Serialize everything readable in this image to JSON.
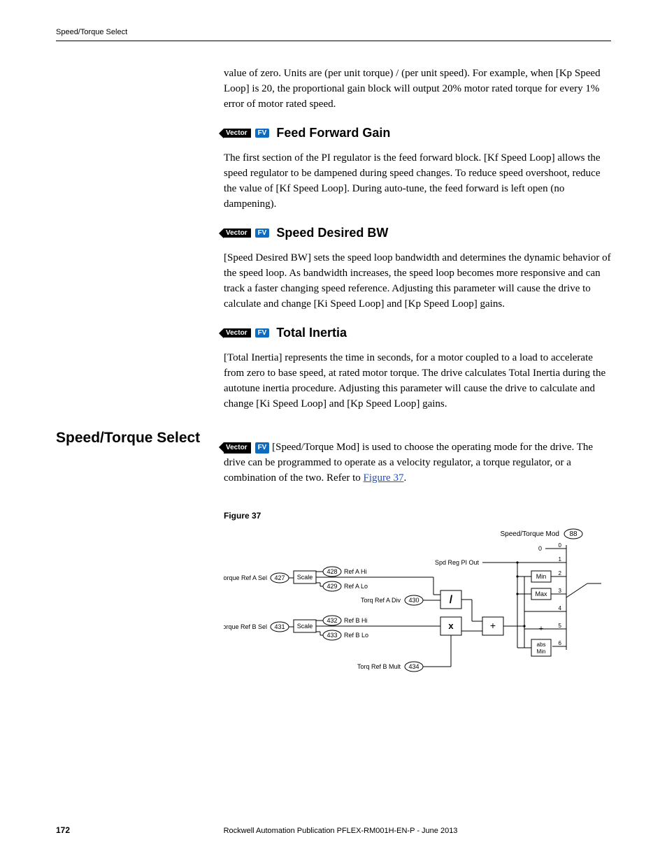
{
  "runhead": "Speed/Torque Select",
  "intro_paragraph": "value of zero. Units are (per unit torque) / (per unit speed). For example, when [Kp Speed Loop] is 20, the proportional gain block will output 20% motor rated torque for every 1% error of motor rated speed.",
  "badges": {
    "vector": "Vector",
    "fv": "FV"
  },
  "sections": {
    "feed_forward": {
      "title": "Feed Forward Gain",
      "body": "The first section of the PI regulator is the feed forward block. [Kf Speed Loop] allows the speed regulator to be dampened during speed changes. To reduce speed overshoot, reduce the value of [Kf Speed Loop]. During auto-tune, the feed forward is left open (no dampening)."
    },
    "speed_desired_bw": {
      "title": "Speed Desired BW",
      "body": "[Speed Desired BW] sets the speed loop bandwidth and determines the dynamic behavior of the speed loop. As bandwidth increases, the speed loop becomes more responsive and can track a faster changing speed reference. Adjusting this parameter will cause the drive to calculate and change [Ki Speed Loop] and [Kp Speed Loop] gains."
    },
    "total_inertia": {
      "title": "Total Inertia",
      "body": "[Total Inertia] represents the time in seconds, for a motor coupled to a load to accelerate from zero to base speed, at rated motor torque. The drive calculates Total Inertia during the autotune inertia procedure. Adjusting this parameter will cause the drive to calculate and change [Ki Speed Loop] and [Kp Speed Loop] gains."
    },
    "speed_torque_select": {
      "title": "Speed/Torque Select",
      "body_before_link": "[Speed/Torque Mod] is used to choose the operating mode for the drive. The drive can be programmed to operate as a velocity regulator, a torque regulator, or a combination of the two. Refer to ",
      "link_text": "Figure 37",
      "body_after_link": "."
    }
  },
  "figure": {
    "label": "Figure 37",
    "labels": {
      "speed_torque_mod": "Speed/Torque Mod",
      "spd_reg_pi_out": "Spd Reg PI Out",
      "torque_ref_a_sel": "Torque Ref A Sel",
      "torque_ref_b_sel": "Torque Ref B Sel",
      "ref_a_hi": "Ref A Hi",
      "ref_a_lo": "Ref A Lo",
      "ref_b_hi": "Ref B Hi",
      "ref_b_lo": "Ref B Lo",
      "torq_ref_a_div": "Torq Ref A Div",
      "torq_ref_b_mult": "Torq Ref B Mult",
      "scale": "Scale",
      "min": "Min",
      "max": "Max",
      "abs_min": "abs\nMin",
      "divide": "/",
      "mult": "x",
      "plus": "+"
    },
    "params": {
      "speed_torque_mod": 88,
      "torque_ref_a_sel": 427,
      "ref_a_hi": 428,
      "ref_a_lo": 429,
      "torq_ref_a_div": 430,
      "torque_ref_b_sel": 431,
      "ref_b_hi": 432,
      "ref_b_lo": 433,
      "torq_ref_b_mult": 434
    },
    "selector_values": [
      0,
      1,
      2,
      3,
      4,
      5,
      6
    ]
  },
  "footer": {
    "page": "172",
    "pub": "Rockwell Automation Publication PFLEX-RM001H-EN-P - June 2013"
  }
}
